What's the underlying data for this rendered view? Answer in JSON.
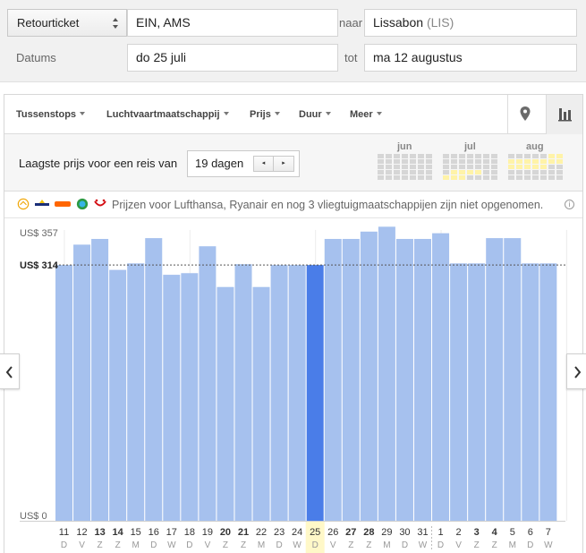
{
  "search": {
    "trip_type": "Retourticket",
    "origin": "EIN, AMS",
    "to_label": "naar",
    "destination_city": "Lissabon",
    "destination_code": "(LIS)",
    "dates_label": "Datums",
    "depart": "do 25 juli",
    "until_label": "tot",
    "return": "ma 12 augustus"
  },
  "filters": {
    "stops": "Tussenstops",
    "airline": "Luchtvaartmaatschappij",
    "price": "Prijs",
    "duration": "Duur",
    "more": "Meer"
  },
  "view_icons": [
    "map-pin-icon",
    "bar-chart-icon"
  ],
  "duration_picker": {
    "label": "Laagste prijs voor een reis van",
    "value": "19 dagen",
    "prev": "◂",
    "next": "▸"
  },
  "months": [
    "jun",
    "jul",
    "aug"
  ],
  "notice": {
    "text": "Prijzen voor Lufthansa, Ryanair en nog 3 vliegtuigmaatschappijen zijn niet opgenomen.",
    "airline_icons": [
      "lufthansa-logo-icon",
      "ryanair-logo-icon",
      "easyjet-logo-icon",
      "transavia-logo-icon",
      "tui-logo-icon"
    ]
  },
  "chart_data": {
    "type": "bar",
    "ylim": [
      0,
      357
    ],
    "y_ticks": [
      "US$ 357",
      "US$ 314",
      "US$ 0"
    ],
    "reference_value": 314,
    "selected_index": 14,
    "categories": [
      "11",
      "12",
      "13",
      "14",
      "15",
      "16",
      "17",
      "18",
      "19",
      "20",
      "21",
      "22",
      "23",
      "24",
      "25",
      "26",
      "27",
      "28",
      "29",
      "30",
      "31",
      "1",
      "2",
      "3",
      "4",
      "5",
      "6",
      "7"
    ],
    "weekdays": [
      "D",
      "V",
      "Z",
      "Z",
      "M",
      "D",
      "W",
      "D",
      "V",
      "Z",
      "Z",
      "M",
      "D",
      "W",
      "D",
      "V",
      "Z",
      "Z",
      "M",
      "D",
      "W",
      "D",
      "V",
      "Z",
      "Z",
      "M",
      "D",
      "W"
    ],
    "bold_days": [
      "13",
      "14",
      "20",
      "21",
      "27",
      "28",
      "3",
      "4"
    ],
    "values": [
      314,
      339,
      346,
      308,
      316,
      347,
      302,
      304,
      337,
      287,
      315,
      287,
      314,
      314,
      314,
      346,
      346,
      355,
      361,
      346,
      346,
      353,
      316,
      316,
      347,
      347,
      316,
      316
    ]
  },
  "colors": {
    "bar": "#a6c1ee",
    "bar_selected": "#4a7de8",
    "highlight": "#fff8c8"
  }
}
